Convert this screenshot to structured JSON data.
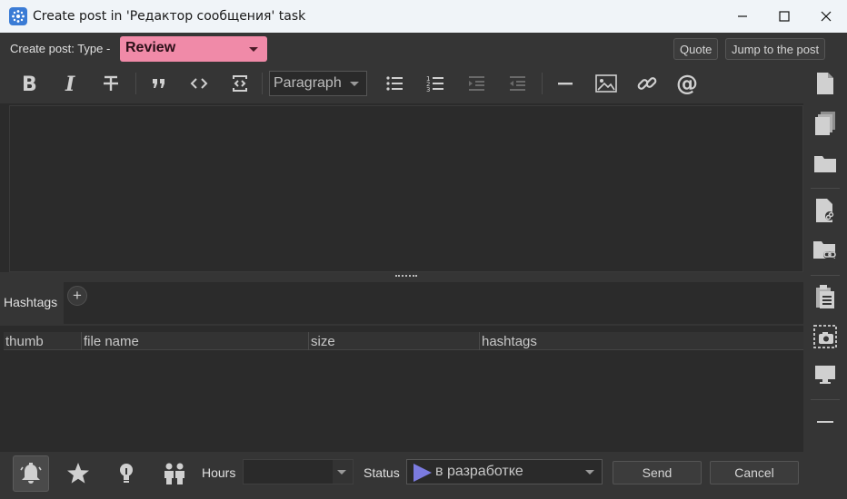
{
  "window": {
    "title": "Create post in 'Редактор сообщения' task",
    "icon": "app-logo-icon",
    "controls": [
      "minimize-icon",
      "maximize-icon",
      "close-icon"
    ]
  },
  "header": {
    "type_label": "Create post: Type -",
    "type_value": "Review",
    "type_color": "#f08aa8",
    "quote_label": "Quote",
    "jump_label": "Jump to the post"
  },
  "toolbar": {
    "paragraph_value": "Paragraph",
    "icons": [
      "bold-icon",
      "italic-icon",
      "strikethrough-icon",
      "blockquote-icon",
      "code-icon",
      "code-block-icon",
      "bullet-list-icon",
      "numbered-list-icon",
      "indent-icon",
      "outdent-icon",
      "horizontal-rule-icon",
      "image-icon",
      "link-icon",
      "mention-icon"
    ]
  },
  "hashtags": {
    "label": "Hashtags",
    "add_symbol": "+"
  },
  "files_table": {
    "columns": [
      "thumb",
      "file name",
      "size",
      "hashtags"
    ],
    "rows": []
  },
  "footer": {
    "hours_label": "Hours",
    "hours_value": "",
    "status_label": "Status",
    "status_value": "в разработке",
    "status_color": "#7b7be0",
    "send_label": "Send",
    "cancel_label": "Cancel",
    "icons": [
      "bell-icon",
      "star-icon",
      "lightbulb-icon",
      "people-icon"
    ]
  },
  "sidebar": {
    "icons": [
      "new-file-icon",
      "copy-files-icon",
      "folder-icon",
      "file-link-icon",
      "folder-link-icon",
      "clipboard-icon",
      "screenshot-icon",
      "monitor-icon",
      "minus-icon"
    ]
  }
}
